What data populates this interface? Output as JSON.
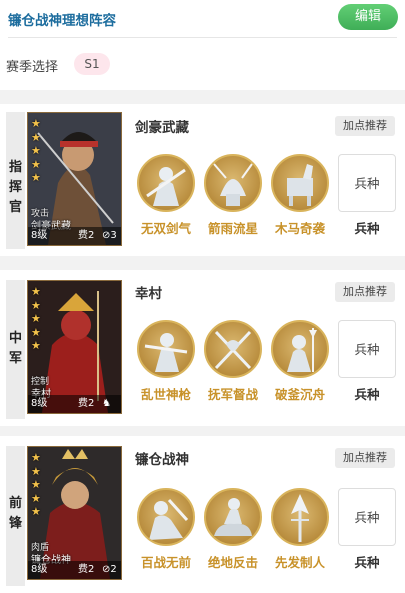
{
  "header": {
    "title": "镰仓战神理想阵容",
    "edit_label": "编辑"
  },
  "season": {
    "label": "赛季选择",
    "value": "S1"
  },
  "colors": {
    "title": "#1d6d9e",
    "edit_button": "#4cbf63",
    "season_pill": "#fde6ec",
    "skill_label": "#c8922a",
    "star": "#f3c24b"
  },
  "recommend_label": "加点推荐",
  "cards": [
    {
      "role_chars": [
        "指",
        "挥",
        "官"
      ],
      "general": "剑豪武藏",
      "stars": 5,
      "portrait": {
        "type": "攻击",
        "name": "剑豪武藏",
        "level": "8级",
        "cost": "费2",
        "restriction": "3"
      },
      "skills": [
        {
          "name": "无双剑气",
          "icon": "swordsman-icon"
        },
        {
          "name": "箭雨流星",
          "icon": "archer-helmet-icon"
        },
        {
          "name": "木马奇袭",
          "icon": "trojan-horse-icon"
        }
      ],
      "troop": {
        "box": "兵种",
        "label": "兵种"
      }
    },
    {
      "role_chars": [
        "中",
        "军"
      ],
      "general": "幸村",
      "stars": 5,
      "portrait": {
        "type": "控制",
        "name": "幸村",
        "level": "8级",
        "cost": "费2",
        "restriction": ""
      },
      "skills": [
        {
          "name": "乱世神枪",
          "icon": "spear-warrior-icon"
        },
        {
          "name": "抚军督战",
          "icon": "crossed-spears-icon"
        },
        {
          "name": "破釜沉舟",
          "icon": "halberd-soldier-icon"
        }
      ],
      "troop": {
        "box": "兵种",
        "label": "兵种"
      }
    },
    {
      "role_chars": [
        "前",
        "锋"
      ],
      "general": "镰仓战神",
      "stars": 5,
      "portrait": {
        "type": "肉盾",
        "name": "镰仓战神",
        "level": "8级",
        "cost": "费2",
        "restriction": "2"
      },
      "skills": [
        {
          "name": "百战无前",
          "icon": "charging-warrior-icon"
        },
        {
          "name": "绝地反击",
          "icon": "mounted-warrior-icon"
        },
        {
          "name": "先发制人",
          "icon": "spearhead-icon"
        }
      ],
      "troop": {
        "box": "兵种",
        "label": "兵种"
      }
    }
  ]
}
